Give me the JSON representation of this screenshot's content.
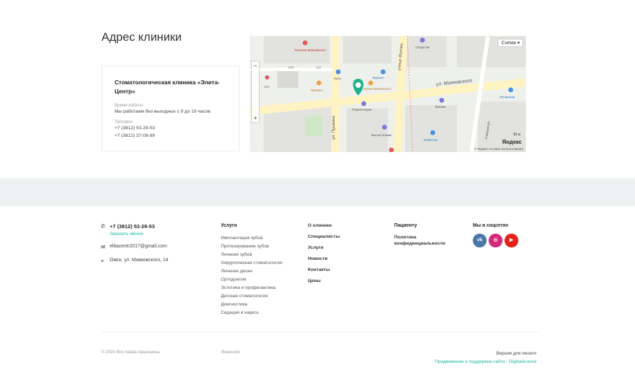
{
  "address_section": {
    "title": "Адрес клиники",
    "clinic_name": "Стоматологическая клиника «Элита-Центр»",
    "hours_label": "Время работы",
    "hours_value": "Мы работаем без выходных с 9 до 19 часов",
    "phone_label": "Телефон",
    "phone_1": "+7 (3812) 53-29-53",
    "phone_2": "+7 (3812) 37-09-89"
  },
  "map": {
    "scheme_button": "Схема ▾",
    "zoom_in": "+",
    "zoom_out": "−",
    "logo": "Яндекс",
    "copyright": "© Яндекс   Условия использования",
    "scale": "50 м",
    "labels": {
      "street_1": "ул. Маяковского",
      "street_2": "ул. Пушкина",
      "street_3": "улица Жукова",
      "street_4": "Учебная ул.",
      "poi_1": "Клиника Маяковского",
      "poi_2": "Открытие",
      "poi_3": "Прованс",
      "poi_4": "Фуршет",
      "poi_5": "Кула",
      "poi_6": "Родилетидом",
      "poi_7": "Жукова",
      "poi_8": "Пятёрочка",
      "poi_9": "Бистро Кэшин",
      "poi_10": "Инвестор",
      "poi_11": "Кулак Маяковского",
      "house_1": "1/20",
      "house_2": "112",
      "house_3": "34/1"
    }
  },
  "footer": {
    "phone": "+7 (3812) 53-29-53",
    "callback": "Заказать звонок",
    "email": "elitacentr2017@gmail.com",
    "address": "Омск, ул. Маяковского, 14",
    "services_head": "Услуги",
    "services": [
      "Имплантация зубов",
      "Протезирование зубов",
      "Лечение зубов",
      "Хирургическая стоматология",
      "Лечение десен",
      "Ортодонтия",
      "Эстетика и профилактика",
      "Детская стоматология",
      "Диагностика",
      "Седация и наркоз"
    ],
    "about_items": [
      "О клинике",
      "Специалисты",
      "Услуги",
      "Новости",
      "Контакты",
      "Цены"
    ],
    "patient_head": "Пациенту",
    "patient_link": "Политика конфиденциальности",
    "social_head": "Мы в соцсетях",
    "social": [
      {
        "name": "vk",
        "label": "vk",
        "color": "#4a76a8"
      },
      {
        "name": "instagram",
        "label": "◎",
        "color": "#d6297a"
      },
      {
        "name": "youtube",
        "label": "▶",
        "color": "#e62117"
      }
    ],
    "copyright": "© 2020 Все права защищены.",
    "license": "Лицензия",
    "print_version": "Версия для печати",
    "developer": "Продвижение и поддержка сайта - DigitalAround"
  },
  "colors": {
    "accent": "#12b89c",
    "band": "#eef1f1"
  }
}
